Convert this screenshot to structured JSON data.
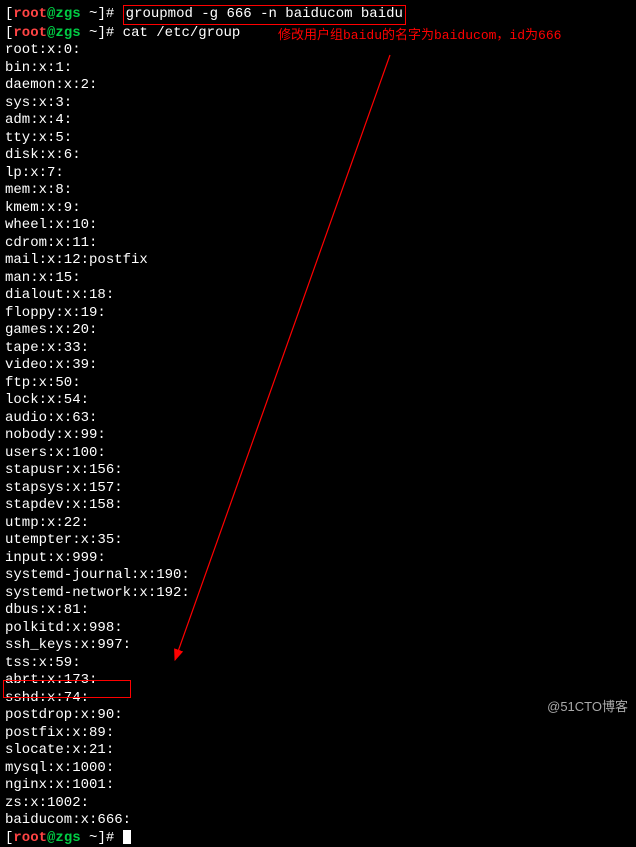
{
  "prompt1": {
    "open": "[",
    "user": "root",
    "at": "@",
    "host": "zgs",
    "dir": "~",
    "close": "]",
    "symbol": "#",
    "command": "groupmod -g 666 -n baiducom baidu"
  },
  "prompt2": {
    "open": "[",
    "user": "root",
    "at": "@",
    "host": "zgs",
    "dir": "~",
    "close": "]",
    "symbol": "#",
    "command": "cat /etc/group"
  },
  "annotation": "修改用户组baidu的名字为baiducom，id为666",
  "groups": [
    "root:x:0:",
    "bin:x:1:",
    "daemon:x:2:",
    "sys:x:3:",
    "adm:x:4:",
    "tty:x:5:",
    "disk:x:6:",
    "lp:x:7:",
    "mem:x:8:",
    "kmem:x:9:",
    "wheel:x:10:",
    "cdrom:x:11:",
    "mail:x:12:postfix",
    "man:x:15:",
    "dialout:x:18:",
    "floppy:x:19:",
    "games:x:20:",
    "tape:x:33:",
    "video:x:39:",
    "ftp:x:50:",
    "lock:x:54:",
    "audio:x:63:",
    "nobody:x:99:",
    "users:x:100:",
    "stapusr:x:156:",
    "stapsys:x:157:",
    "stapdev:x:158:",
    "utmp:x:22:",
    "utempter:x:35:",
    "input:x:999:",
    "systemd-journal:x:190:",
    "systemd-network:x:192:",
    "dbus:x:81:",
    "polkitd:x:998:",
    "ssh_keys:x:997:",
    "tss:x:59:",
    "abrt:x:173:",
    "sshd:x:74:",
    "postdrop:x:90:",
    "postfix:x:89:",
    "slocate:x:21:",
    "mysql:x:1000:",
    "nginx:x:1001:",
    "zs:x:1002:",
    "baiducom:x:666:"
  ],
  "prompt3": {
    "open": "[",
    "user": "root",
    "at": "@",
    "host": "zgs",
    "dir": "~",
    "close": "]",
    "symbol": "#"
  },
  "watermark": "@51CTO博客",
  "colors": {
    "red": "#ff0000",
    "green": "#00cc44",
    "user_red": "#ff4444",
    "bg": "#000000",
    "fg": "#ffffff"
  }
}
